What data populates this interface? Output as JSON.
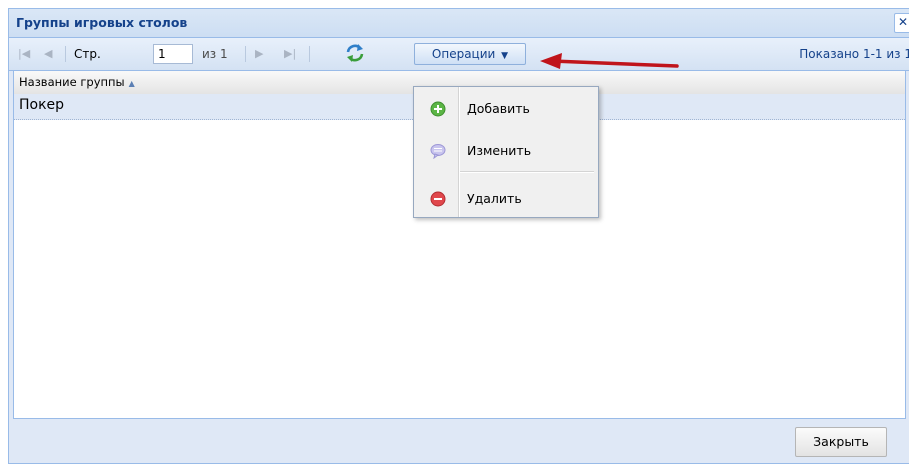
{
  "window": {
    "title": "Группы игровых столов",
    "close_glyph": "✕"
  },
  "toolbar": {
    "first_icon": "first-page-icon",
    "prev_icon": "prev-page-icon",
    "page_label": "Стр.",
    "page_value": "1",
    "of_label": "из 1",
    "next_icon": "next-page-icon",
    "last_icon": "last-page-icon",
    "refresh_icon": "refresh-icon",
    "operations_label": "Операции",
    "operations_arrow": "▼",
    "displaying": "Показано 1-1 из 1"
  },
  "grid": {
    "column_header": "Название группы",
    "rows": [
      {
        "name": "Покер"
      }
    ]
  },
  "menu": {
    "items": [
      {
        "label": "Добавить",
        "icon": "add-icon"
      },
      {
        "label": "Изменить",
        "icon": "edit-icon"
      },
      {
        "label": "Удалить",
        "icon": "delete-icon"
      }
    ]
  },
  "footer": {
    "close_label": "Закрыть"
  },
  "colors": {
    "title_blue": "#15428b",
    "panel_bg": "#dfe8f6",
    "border": "#99bbe8",
    "annotation_arrow": "#c0141a",
    "add_green": "#5bb545",
    "delete_red": "#e0474c",
    "edit_lavender": "#b8b4e6"
  }
}
